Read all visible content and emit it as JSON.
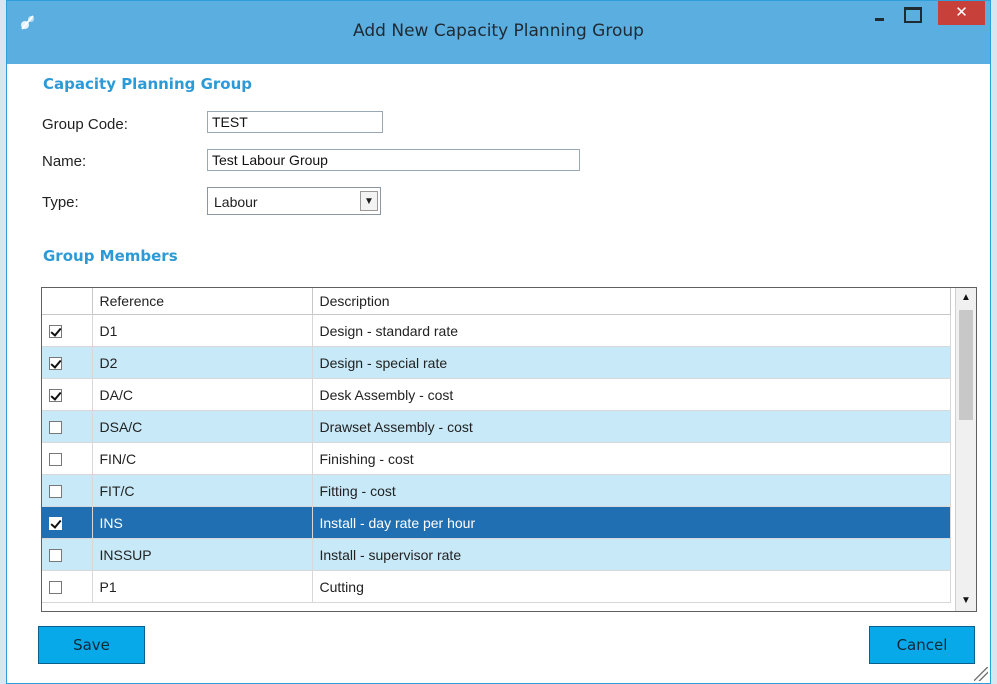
{
  "window": {
    "title": "Add New Capacity Planning Group",
    "close_glyph": "✕",
    "accent_color": "#5aaee0"
  },
  "sections": {
    "group_heading": "Capacity Planning Group",
    "members_heading": "Group Members"
  },
  "form": {
    "group_code_label": "Group Code:",
    "group_code_value": "TEST",
    "name_label": "Name:",
    "name_value": "Test Labour Group",
    "type_label": "Type:",
    "type_value": "Labour"
  },
  "grid": {
    "columns": [
      "Reference",
      "Description"
    ],
    "rows": [
      {
        "checked": true,
        "reference": "D1",
        "description": "Design - standard rate"
      },
      {
        "checked": true,
        "reference": "D2",
        "description": "Design - special rate"
      },
      {
        "checked": true,
        "reference": "DA/C",
        "description": "Desk Assembly - cost"
      },
      {
        "checked": false,
        "reference": "DSA/C",
        "description": "Drawset Assembly - cost"
      },
      {
        "checked": false,
        "reference": "FIN/C",
        "description": "Finishing - cost"
      },
      {
        "checked": false,
        "reference": "FIT/C",
        "description": "Fitting - cost"
      },
      {
        "checked": true,
        "reference": "INS",
        "description": "Install - day rate per hour",
        "selected": true
      },
      {
        "checked": false,
        "reference": "INSSUP",
        "description": "Install - supervisor rate"
      },
      {
        "checked": false,
        "reference": "P1",
        "description": "Cutting"
      }
    ]
  },
  "buttons": {
    "save_label": "Save",
    "cancel_label": "Cancel"
  },
  "icons": {
    "app": "app-logo-icon",
    "minimize": "minimize-icon",
    "maximize": "maximize-icon",
    "close": "close-icon",
    "dropdown": "chevron-down-icon",
    "resize": "resize-grip-icon"
  }
}
